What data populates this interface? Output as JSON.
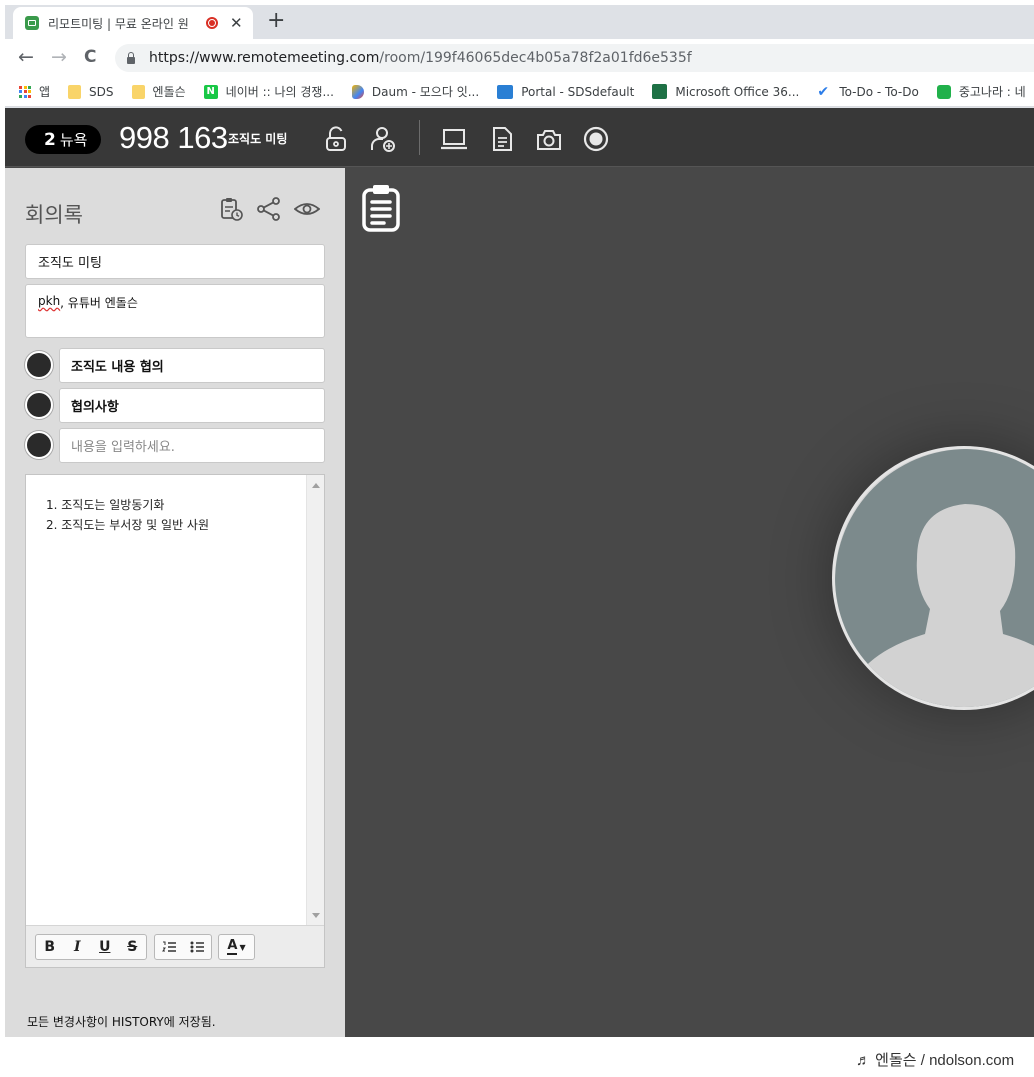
{
  "browser": {
    "tab_title": "리모트미팅 | 무료 온라인 원",
    "close_glyph": "✕",
    "newtab_glyph": "+",
    "back_glyph": "←",
    "forward_glyph": "→",
    "reload_glyph": "C",
    "url_host": "https://www.remotemeeting.com",
    "url_path": "/room/199f46065dec4b05a78f2a01fd6e535f",
    "bookmarks": [
      {
        "label": "앱",
        "icon": "apps-grid-icon"
      },
      {
        "label": "SDS",
        "icon": "folder-icon",
        "color": "#f9d469"
      },
      {
        "label": "엔돌슨",
        "icon": "folder-icon",
        "color": "#f9d469"
      },
      {
        "label": "네이버 :: 나의 경쟁...",
        "icon": "naver-icon",
        "color": "#19c846"
      },
      {
        "label": "Daum - 모으다 잇...",
        "icon": "daum-icon",
        "color": "#4286f5"
      },
      {
        "label": "Portal - SDSdefault",
        "icon": "portal-icon",
        "color": "#2a7fd4"
      },
      {
        "label": "Microsoft Office 36...",
        "icon": "office-icon",
        "color": "#1e7145"
      },
      {
        "label": "To-Do - To-Do",
        "icon": "check-icon",
        "color": "#2b7de9"
      },
      {
        "label": "중고나라 : 네",
        "icon": "joonggo-icon",
        "color": "#21b14b"
      }
    ]
  },
  "meeting": {
    "participant_count": "2",
    "participant_label": "뉴욕",
    "room_number": "998 163",
    "room_name": "조직도 미팅"
  },
  "minutes": {
    "title": "회의록",
    "meeting_title_value": "조직도 미팅",
    "participants_first": "pkh",
    "participants_rest": ", 유튜버 엔돌슨",
    "agenda": [
      {
        "value": "조직도 내용 협의"
      },
      {
        "value": "협의사항"
      },
      {
        "placeholder": "내용을 입력하세요."
      }
    ],
    "editor_lines": [
      "1. 조직도는 일방동기화",
      "2. 조직도는 부서장 및 일반 사원"
    ],
    "format_buttons": {
      "bold": "B",
      "italic": "I",
      "underline": "U",
      "strike": "S",
      "color": "A"
    },
    "status": "모든 변경사항이 HISTORY에 저장됨."
  },
  "watermark": "♬ 엔돌슨 / ndolson.com"
}
